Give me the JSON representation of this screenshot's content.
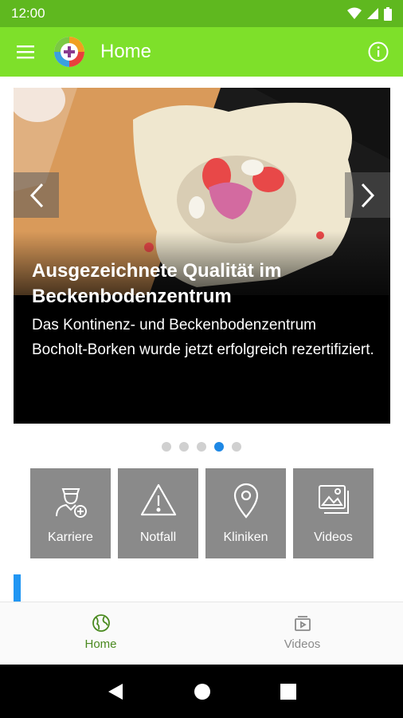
{
  "status_bar": {
    "time": "12:00"
  },
  "app_bar": {
    "title": "Home"
  },
  "carousel": {
    "slide_title": "Ausgezeichnete Qualität im Beckenbodenzentrum",
    "slide_text": "Das Kontinenz- und Beckenbodenzentrum Bocholt-Borken wurde jetzt erfolgreich rezertifiziert.",
    "total_slides": 5,
    "active_slide_index": 3
  },
  "tiles": [
    {
      "label": "Karriere",
      "icon": "doctor-add-icon"
    },
    {
      "label": "Notfall",
      "icon": "warning-icon"
    },
    {
      "label": "Kliniken",
      "icon": "location-pin-icon"
    },
    {
      "label": "Videos",
      "icon": "gallery-icon"
    }
  ],
  "bottom_nav": {
    "items": [
      {
        "label": "Home",
        "icon": "globe-icon",
        "active": true
      },
      {
        "label": "Videos",
        "icon": "video-icon",
        "active": false
      }
    ]
  },
  "colors": {
    "app_bar": "#7ee02a",
    "status_bar": "#5fb81f",
    "tile": "#8a8a8a",
    "active_dot": "#1e88e5",
    "active_nav": "#4a8a1f"
  }
}
